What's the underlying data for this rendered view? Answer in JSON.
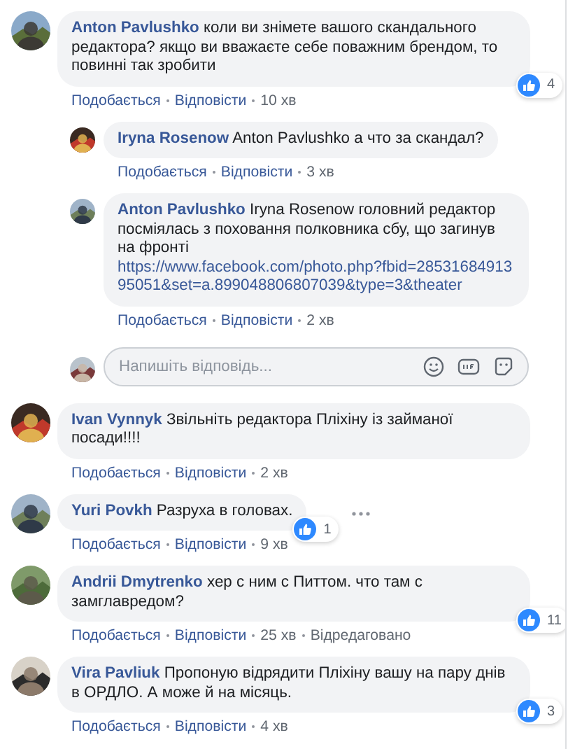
{
  "comments": [
    {
      "author": "Anton Pavlushko",
      "text": "коли ви знімете вашого скандального редактора? якщо ви вважаєте себе поважним брендом, то повинні так зробити",
      "reactions": "4",
      "actions": [
        "Подобається",
        "Відповісти"
      ],
      "time": "10 хв",
      "replies": [
        {
          "author": "Iryna Rosenow",
          "text": "Anton Pavlushko а что за скандал?",
          "actions": [
            "Подобається",
            "Відповісти"
          ],
          "time": "3 хв"
        },
        {
          "author": "Anton Pavlushko",
          "text": "Iryna Rosenow головний редактор посміялась з поховання полковника сбу, що загинув на фронті",
          "link": "https://www.facebook.com/photo.php?fbid=2853168491395051&set=a.899048806807039&type=3&theater",
          "actions": [
            "Подобається",
            "Відповісти"
          ],
          "time": "2 хв"
        }
      ],
      "reply_box": {
        "placeholder": "Напишіть відповідь..."
      }
    },
    {
      "author": "Ivan Vynnyk",
      "text": "Звільніть редактора Пліхіну із займаної посади!!!!",
      "actions": [
        "Подобається",
        "Відповісти"
      ],
      "time": "2 хв"
    },
    {
      "author": "Yuri Povkh",
      "text": "Разруха в головах.",
      "reactions": "1",
      "more_menu": true,
      "actions": [
        "Подобається",
        "Відповісти"
      ],
      "time": "9 хв"
    },
    {
      "author": "Andrii Dmytrenko",
      "text": "хер с ним с Питтом. что там с замглавредом?",
      "reactions": "11",
      "actions": [
        "Подобається",
        "Відповісти"
      ],
      "time": "25 хв",
      "edited": "Відредаговано"
    },
    {
      "author": "Vira Pavliuk",
      "text": "Пропоную відрядити Пліхіну вашу на пару днів в ОРДЛО. А може й на місяць.",
      "reactions": "3",
      "actions": [
        "Подобається",
        "Відповісти"
      ],
      "time": "4 хв"
    }
  ]
}
